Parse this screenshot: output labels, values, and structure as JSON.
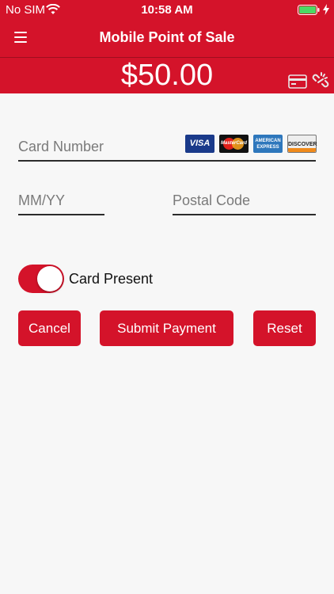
{
  "status_bar": {
    "carrier": "No SIM",
    "time": "10:58 AM"
  },
  "nav": {
    "title": "Mobile Point of Sale",
    "menu_icon": "hamburger-icon"
  },
  "payment": {
    "amount": "$50.00",
    "reader_icon": "card-reader-icon",
    "connection_icon": "disconnected-link-icon"
  },
  "form": {
    "card_number_placeholder": "Card Number",
    "expiry_placeholder": "MM/YY",
    "postal_placeholder": "Postal Code",
    "card_logos": {
      "visa": "VISA",
      "mastercard": "MasterCard",
      "amex": "AMERICAN EXPRESS",
      "discover": "DISCOVER"
    },
    "card_present_label": "Card Present",
    "card_present_on": true
  },
  "buttons": {
    "cancel": "Cancel",
    "submit": "Submit Payment",
    "reset": "Reset"
  },
  "colors": {
    "brand": "#d4132a",
    "background": "#f7f7f7"
  }
}
